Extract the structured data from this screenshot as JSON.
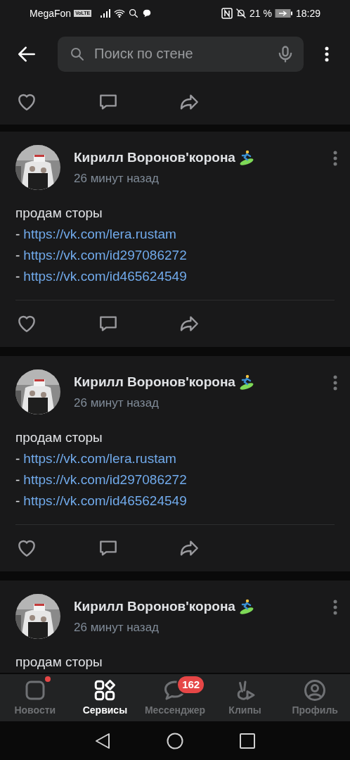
{
  "status_bar": {
    "carrier": "MegaFon",
    "volte": "VoLTE",
    "battery": "21 %",
    "time": "18:29"
  },
  "search": {
    "placeholder": "Поиск по стене"
  },
  "posts": [
    {
      "author": "Кирилл Воронов'корона",
      "time": "26 минут назад",
      "text": "продам сторы",
      "links": [
        "https://vk.com/lera.rustam",
        "https://vk.com/id297086272",
        "https://vk.com/id465624549"
      ]
    },
    {
      "author": "Кирилл Воронов'корона",
      "time": "26 минут назад",
      "text": "продам сторы",
      "links": [
        "https://vk.com/lera.rustam",
        "https://vk.com/id297086272",
        "https://vk.com/id465624549"
      ]
    },
    {
      "author": "Кирилл Воронов'корона",
      "time": "26 минут назад",
      "text": "продам сторы"
    }
  ],
  "list_marker": "-",
  "tabs": [
    {
      "label": "Новости",
      "selected": false,
      "dot": true
    },
    {
      "label": "Сервисы",
      "selected": true
    },
    {
      "label": "Мессенджер",
      "selected": false,
      "badge": "162"
    },
    {
      "label": "Клипы",
      "selected": false
    },
    {
      "label": "Профиль",
      "selected": false
    }
  ]
}
